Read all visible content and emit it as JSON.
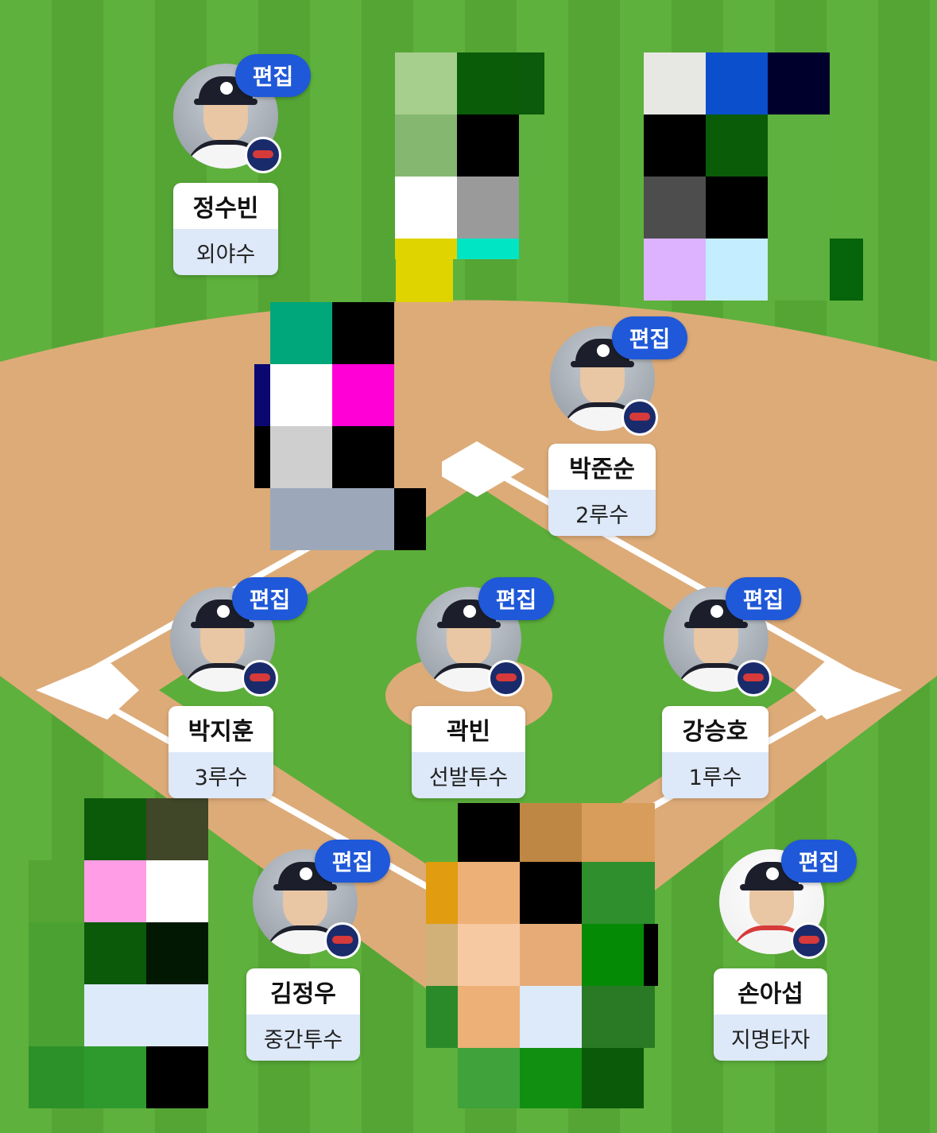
{
  "edit_label": "편집",
  "players": [
    {
      "id": "lf",
      "name": "정수빈",
      "position": "외야수"
    },
    {
      "id": "2b",
      "name": "박준순",
      "position": "2루수"
    },
    {
      "id": "3b",
      "name": "박지훈",
      "position": "3루수"
    },
    {
      "id": "sp",
      "name": "곽빈",
      "position": "선발투수"
    },
    {
      "id": "1b",
      "name": "강승호",
      "position": "1루수"
    },
    {
      "id": "rp",
      "name": "김정우",
      "position": "중간투수"
    },
    {
      "id": "dh",
      "name": "손아섭",
      "position": "지명타자"
    }
  ],
  "colors": {
    "edit_button": "#1f58d8",
    "position_label_bg": "#dde8f8",
    "infield_dirt": "#ddab78",
    "grass": "#5cae3a"
  }
}
